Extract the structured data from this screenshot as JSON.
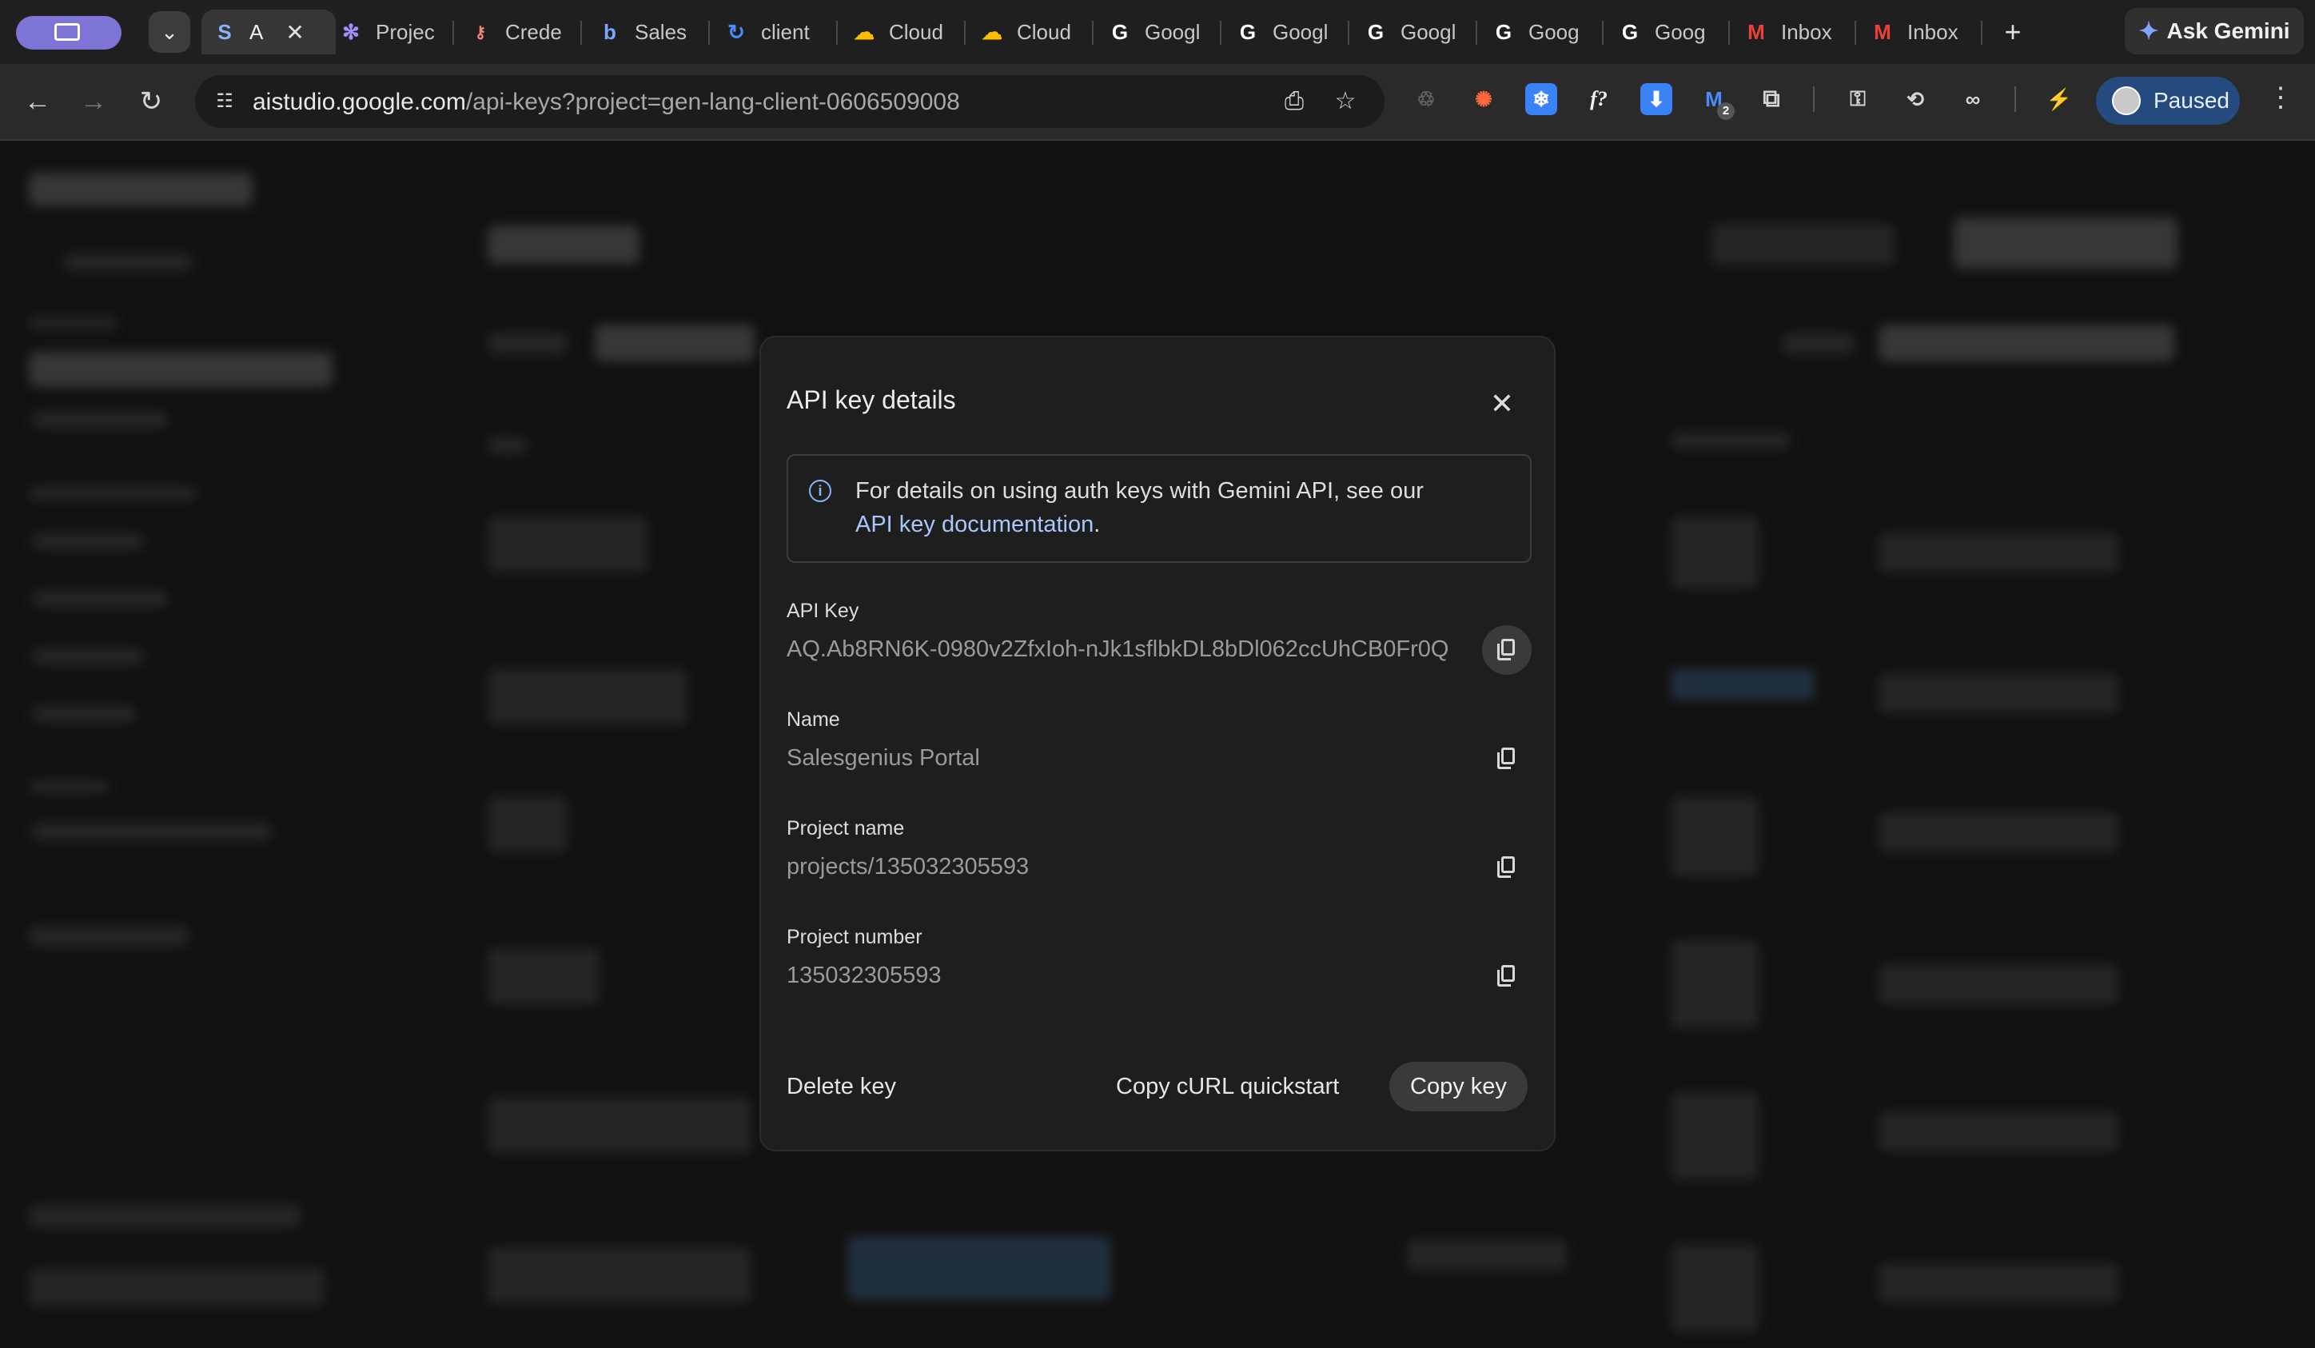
{
  "browser": {
    "tabs": [
      {
        "label": "A",
        "active": true,
        "icon": "ai-studio-icon"
      },
      {
        "label": "Projec",
        "icon": "asterisk-icon"
      },
      {
        "label": "Crede",
        "icon": "key-icon"
      },
      {
        "label": "Sales",
        "icon": "salesgenius-icon"
      },
      {
        "label": "client",
        "icon": "sync-icon"
      },
      {
        "label": "Cloud",
        "icon": "cloud-icon"
      },
      {
        "label": "Cloud",
        "icon": "cloud-icon"
      },
      {
        "label": "Googl",
        "icon": "google-icon"
      },
      {
        "label": "Googl",
        "icon": "google-icon"
      },
      {
        "label": "Googl",
        "icon": "google-icon"
      },
      {
        "label": "Goog",
        "icon": "google-icon"
      },
      {
        "label": "Goog",
        "icon": "google-icon"
      },
      {
        "label": "Inbox",
        "icon": "gmail-icon"
      },
      {
        "label": "Inbox",
        "icon": "gmail-icon"
      }
    ],
    "ask_gemini": "Ask Gemini",
    "url_host": "aistudio.google.com",
    "url_path": "/api-keys?project=gen-lang-client-0606509008",
    "profile_status": "Paused",
    "extension_badge": "2"
  },
  "modal": {
    "title": "API key details",
    "info_text_1": "For details on using auth keys with Gemini API, see our",
    "info_link": "API key documentation",
    "info_text_2_suffix": ".",
    "fields": [
      {
        "label": "API Key",
        "value": "AQ.Ab8RN6K-0980v2ZfxIoh-nJk1sflbkDL8bDl062ccUhCB0Fr0Q"
      },
      {
        "label": "Name",
        "value": "Salesgenius Portal"
      },
      {
        "label": "Project name",
        "value": "projects/135032305593"
      },
      {
        "label": "Project number",
        "value": "135032305593"
      }
    ],
    "buttons": {
      "delete": "Delete key",
      "curl": "Copy cURL quickstart",
      "copy": "Copy key"
    }
  },
  "colors": {
    "accent_link": "#a8c7fa",
    "profile_pill": "#7c75d6",
    "paused_bg": "#244a7e"
  }
}
